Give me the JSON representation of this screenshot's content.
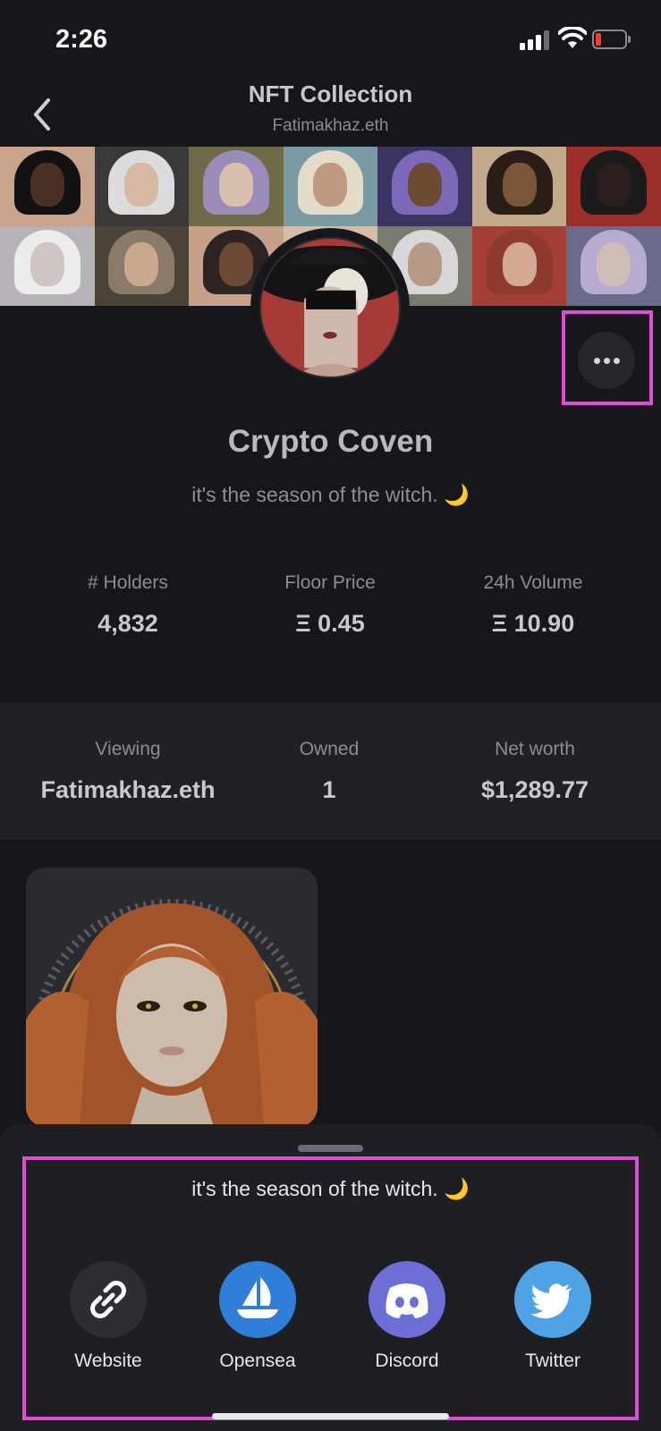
{
  "status_bar": {
    "time": "2:26"
  },
  "nav": {
    "title": "NFT Collection",
    "subtitle": "Fatimakhaz.eth"
  },
  "collection": {
    "name": "Crypto Coven",
    "description": "it's the season of the witch. 🌙"
  },
  "stats": [
    {
      "label": "# Holders",
      "value": "4,832"
    },
    {
      "label": "Floor Price",
      "value": "Ξ 0.45"
    },
    {
      "label": "24h Volume",
      "value": "Ξ 10.90"
    }
  ],
  "viewing": [
    {
      "label": "Viewing",
      "value": "Fatimakhaz.eth"
    },
    {
      "label": "Owned",
      "value": "1"
    },
    {
      "label": "Net worth",
      "value": "$1,289.77"
    }
  ],
  "sheet": {
    "description": "it's the season of the witch. 🌙",
    "links": [
      {
        "label": "Website",
        "icon": "link-icon",
        "color": "#2c2e33"
      },
      {
        "label": "Opensea",
        "icon": "opensea-icon",
        "color": "#2f7fd9"
      },
      {
        "label": "Discord",
        "icon": "discord-icon",
        "color": "#6e6fd6"
      },
      {
        "label": "Twitter",
        "icon": "twitter-icon",
        "color": "#4ea2e6"
      }
    ]
  },
  "colors": {
    "background": "#15171b",
    "panel": "#1f2125",
    "highlight": "#e04bd8"
  }
}
